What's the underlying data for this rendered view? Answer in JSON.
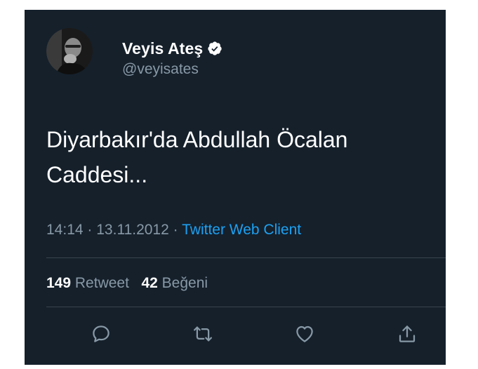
{
  "user": {
    "display_name": "Veyis Ateş",
    "handle": "@veyisates",
    "verified": true
  },
  "tweet": {
    "text_line1": "Diyarbakır'da Abdullah Öcalan",
    "text_line2": "Caddesi...",
    "time": "14:14",
    "date": "13.11.2012",
    "separator": "·",
    "source": "Twitter Web Client"
  },
  "stats": {
    "retweets_count": "149",
    "retweets_label": "Retweet",
    "likes_count": "42",
    "likes_label": "Beğeni"
  },
  "actions": [
    "reply-icon",
    "retweet-icon",
    "like-icon",
    "share-icon"
  ],
  "colors": {
    "background": "#15202b",
    "primary_text": "#ffffff",
    "secondary_text": "#8899a6",
    "link": "#1da1f2",
    "divider": "#38444d"
  }
}
